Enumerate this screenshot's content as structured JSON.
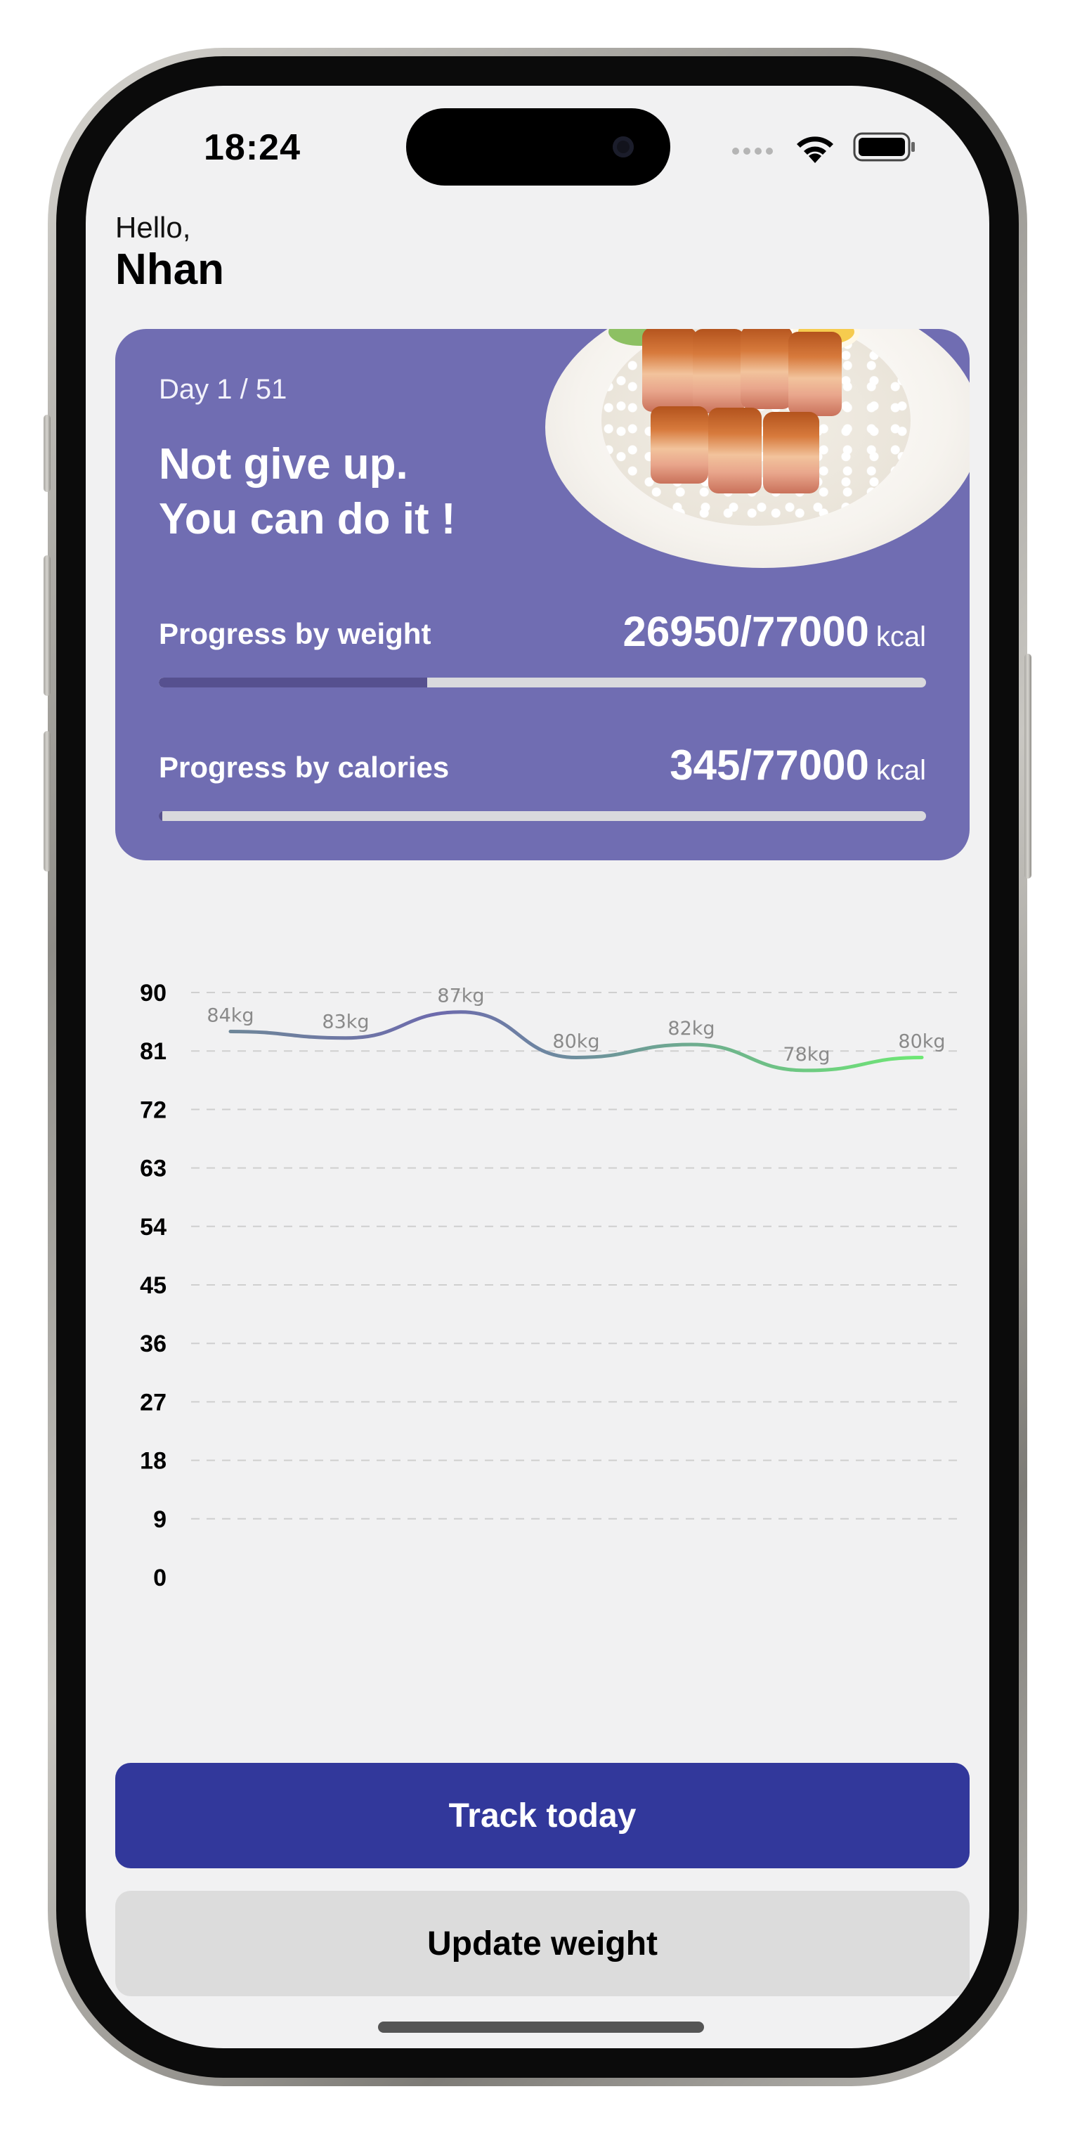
{
  "status_bar": {
    "time": "18:24",
    "icons": [
      "cellular-icon",
      "wifi-icon",
      "battery-icon"
    ]
  },
  "greeting": {
    "hello": "Hello,",
    "name": "Nhan"
  },
  "hero_card": {
    "background": "#706db2",
    "image": "food-plate-image",
    "day": "Day 1 / 51",
    "motto_line1": "Not give up.",
    "motto_line2": "You can do it !",
    "progress_weight": {
      "label": "Progress by weight",
      "value": "26950/77000",
      "unit": "kcal",
      "fraction": 0.35
    },
    "progress_calories": {
      "label": "Progress by calories",
      "value": "345/77000",
      "unit": "kcal",
      "fraction": 0.0045
    }
  },
  "chart_data": {
    "type": "line",
    "title": "",
    "xlabel": "",
    "ylabel": "",
    "ylim": [
      0,
      90
    ],
    "y_ticks": [
      "90",
      "81",
      "72",
      "63",
      "54",
      "45",
      "36",
      "27",
      "18",
      "9",
      "0"
    ],
    "grid": true,
    "series": [
      {
        "values": [
          84,
          83,
          87,
          80,
          82,
          78,
          80
        ],
        "labels": [
          "84kg",
          "83kg",
          "87kg",
          "80kg",
          "82kg",
          "78kg",
          "80kg"
        ],
        "color_start": "#6e8799",
        "color_mid": "#6d6aad",
        "color_end": "#6ee874"
      }
    ]
  },
  "actions": {
    "track_today": "Track today",
    "update_weight": "Update weight",
    "primary_color": "#32389b"
  }
}
